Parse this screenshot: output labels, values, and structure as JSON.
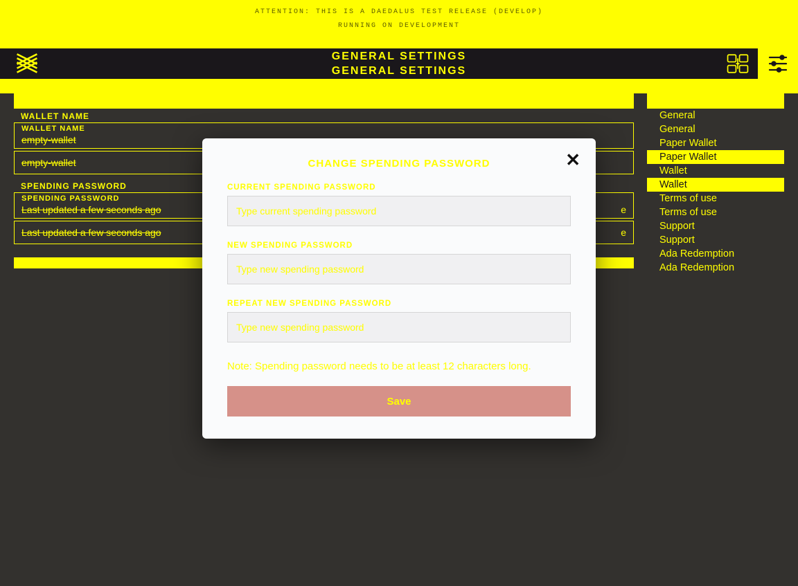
{
  "banner": {
    "line1": "ATTENTION: THIS IS A DAEDALUS TEST RELEASE (DEVELOP)",
    "line2": "RUNNING ON DEVELOPMENT"
  },
  "header": {
    "title1": "GENERAL SETTINGS",
    "title2": "GENERAL SETTINGS"
  },
  "sidebar": {
    "items": [
      {
        "label": "General",
        "selected": false
      },
      {
        "label": "General",
        "selected": false
      },
      {
        "label": "Paper Wallet",
        "selected": false
      },
      {
        "label": "Paper Wallet",
        "selected": true
      },
      {
        "label": "Wallet",
        "selected": false
      },
      {
        "label": "Wallet",
        "selected": true
      },
      {
        "label": "Terms of use",
        "selected": false
      },
      {
        "label": "Terms of use",
        "selected": false
      },
      {
        "label": "Support",
        "selected": false
      },
      {
        "label": "Support",
        "selected": false
      },
      {
        "label": "Ada Redemption",
        "selected": false
      },
      {
        "label": "Ada Redemption",
        "selected": false
      }
    ]
  },
  "settings": {
    "wallet_name_caption": "WALLET NAME",
    "wallet_name_caption2": "WALLET NAME",
    "wallet_name_value1": "empty-wallet",
    "wallet_name_value2": "empty-wallet",
    "spending_caption": "SPENDING PASSWORD",
    "spending_caption2": "SPENDING PASSWORD",
    "spending_value1": "Last updated a few seconds ago",
    "spending_value2": "Last updated a few seconds ago",
    "spending_suffix1": "e",
    "spending_suffix2": "e"
  },
  "dialog": {
    "title": "CHANGE SPENDING PASSWORD",
    "current_label": "CURRENT SPENDING PASSWORD",
    "current_placeholder": "Type current spending password",
    "new_label": "NEW SPENDING PASSWORD",
    "new_placeholder": "Type new spending password",
    "repeat_label": "REPEAT NEW SPENDING PASSWORD",
    "repeat_placeholder": "Type new spending password",
    "note": "Note: Spending password needs to be at least 12 characters long.",
    "save": "Save"
  }
}
